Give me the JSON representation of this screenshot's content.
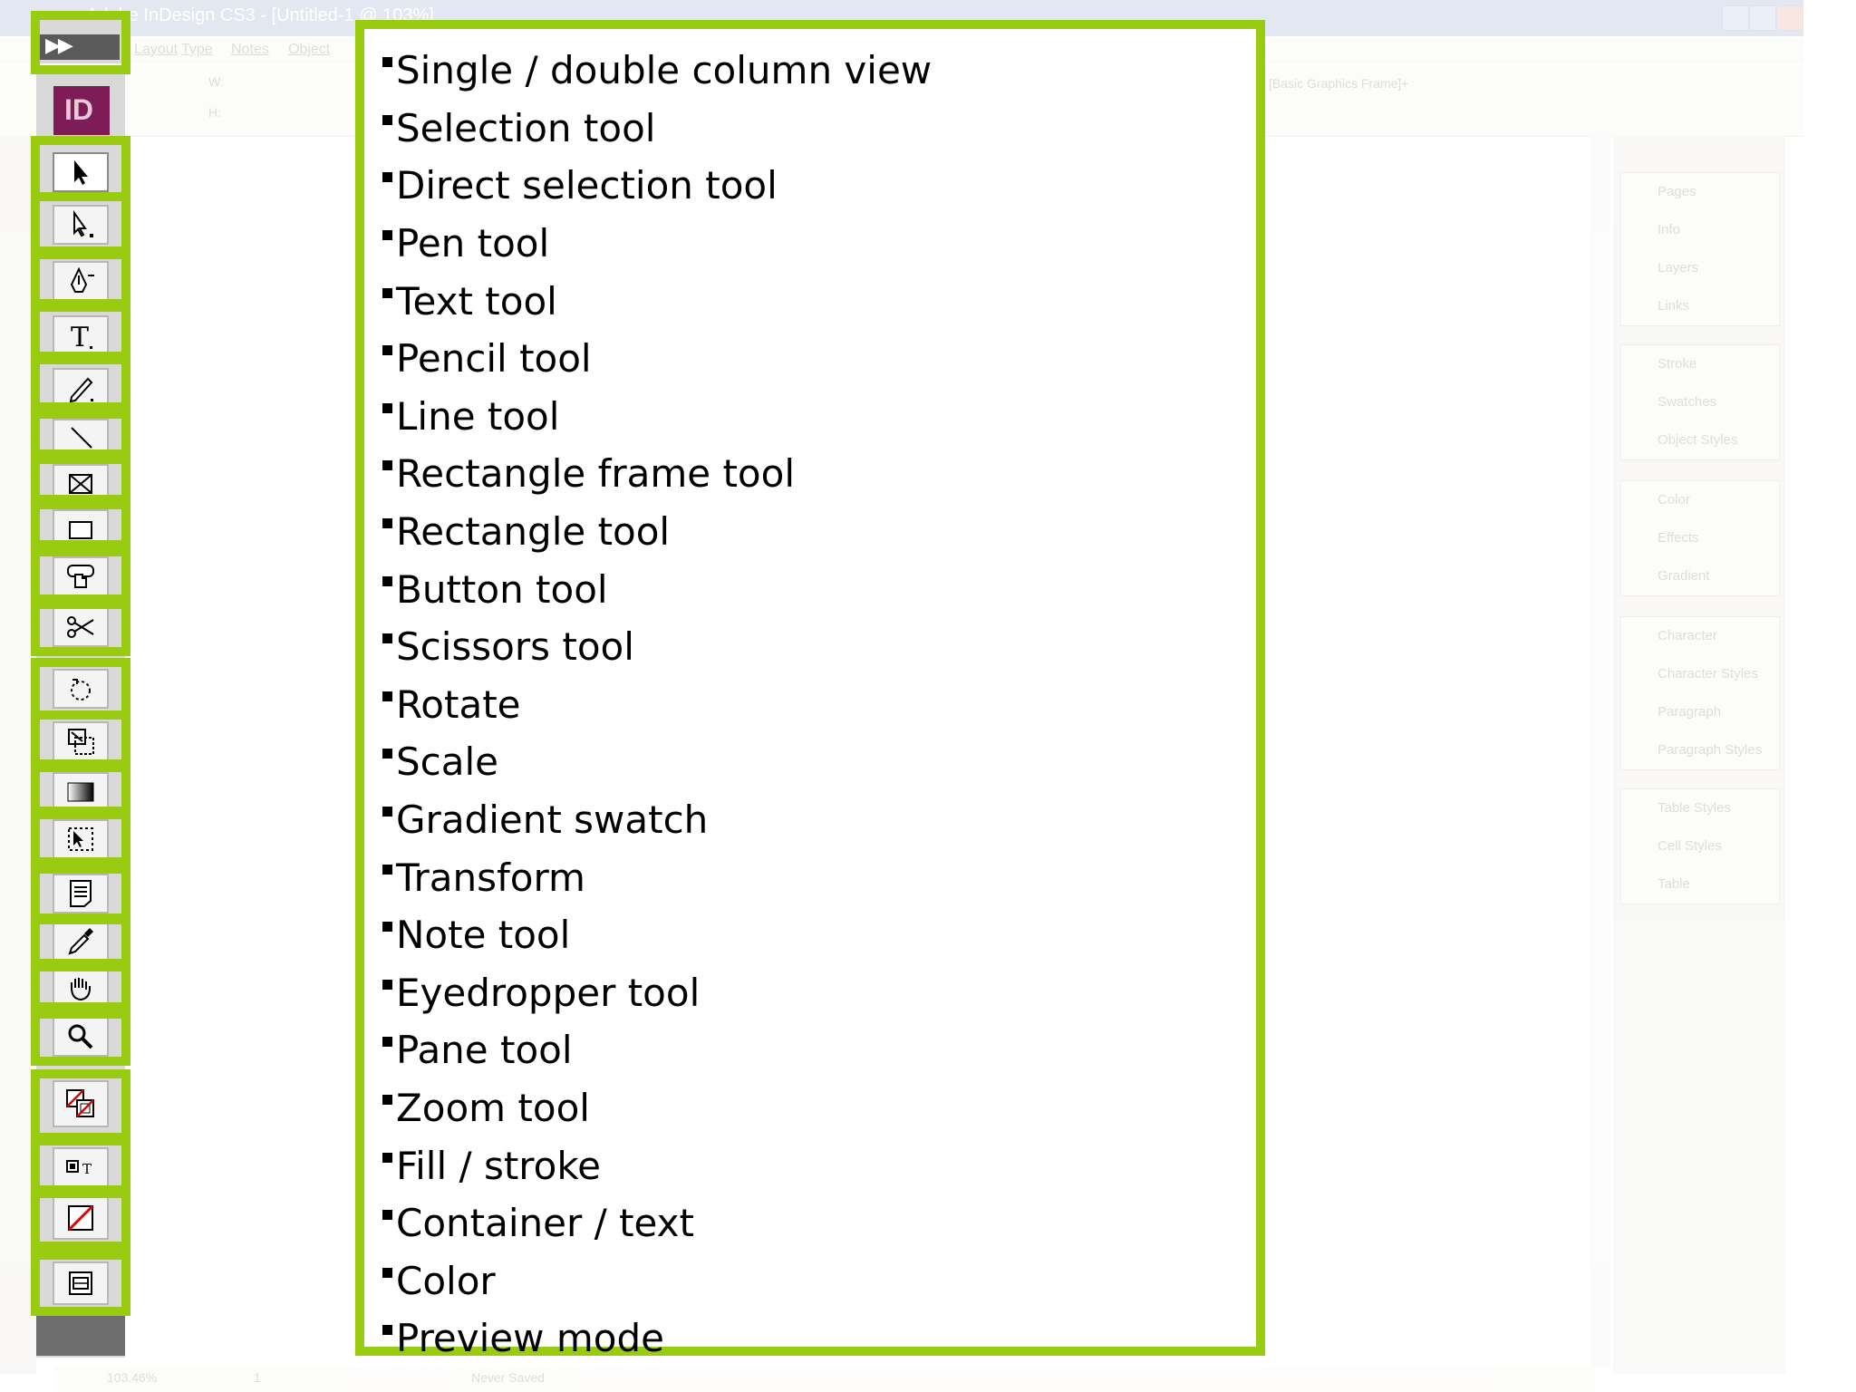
{
  "window": {
    "title": "Adobe InDesign CS3 - [Untitled-1 @ 103%]",
    "menu": [
      "Layout",
      "Type",
      "Notes",
      "Object"
    ],
    "control_labels": [
      "W:",
      "H:"
    ],
    "frame_type": "[Basic Graphics Frame]+"
  },
  "panels": {
    "group1": [
      "Pages",
      "Info",
      "Layers",
      "Links"
    ],
    "group2": [
      "Stroke",
      "Swatches",
      "Object Styles"
    ],
    "group3": [
      "Color",
      "Effects",
      "Gradient"
    ],
    "group4": [
      "Character",
      "Character Styles",
      "Paragraph",
      "Paragraph Styles"
    ],
    "group5": [
      "Table Styles",
      "Cell Styles",
      "Table"
    ]
  },
  "status": {
    "zoom": "103.46%",
    "page": "1",
    "save_state": "Never Saved"
  },
  "toolbox": {
    "logo": "ID",
    "collapse": "▶▶"
  },
  "labels": [
    "Single / double column view",
    "Selection tool",
    "Direct selection tool",
    "Pen tool",
    "Text tool",
    "Pencil tool",
    "Line tool",
    "Rectangle frame tool",
    "Rectangle tool",
    "Button tool",
    "Scissors tool",
    "Rotate",
    "Scale",
    "Gradient swatch",
    "Transform",
    "Note tool",
    "Eyedropper tool",
    "Pane tool",
    "Zoom tool",
    "Fill / stroke",
    "Container / text",
    "Color",
    "Preview mode"
  ],
  "colors": {
    "highlight": "#99cc11",
    "logo_bg": "#7d1c56"
  }
}
